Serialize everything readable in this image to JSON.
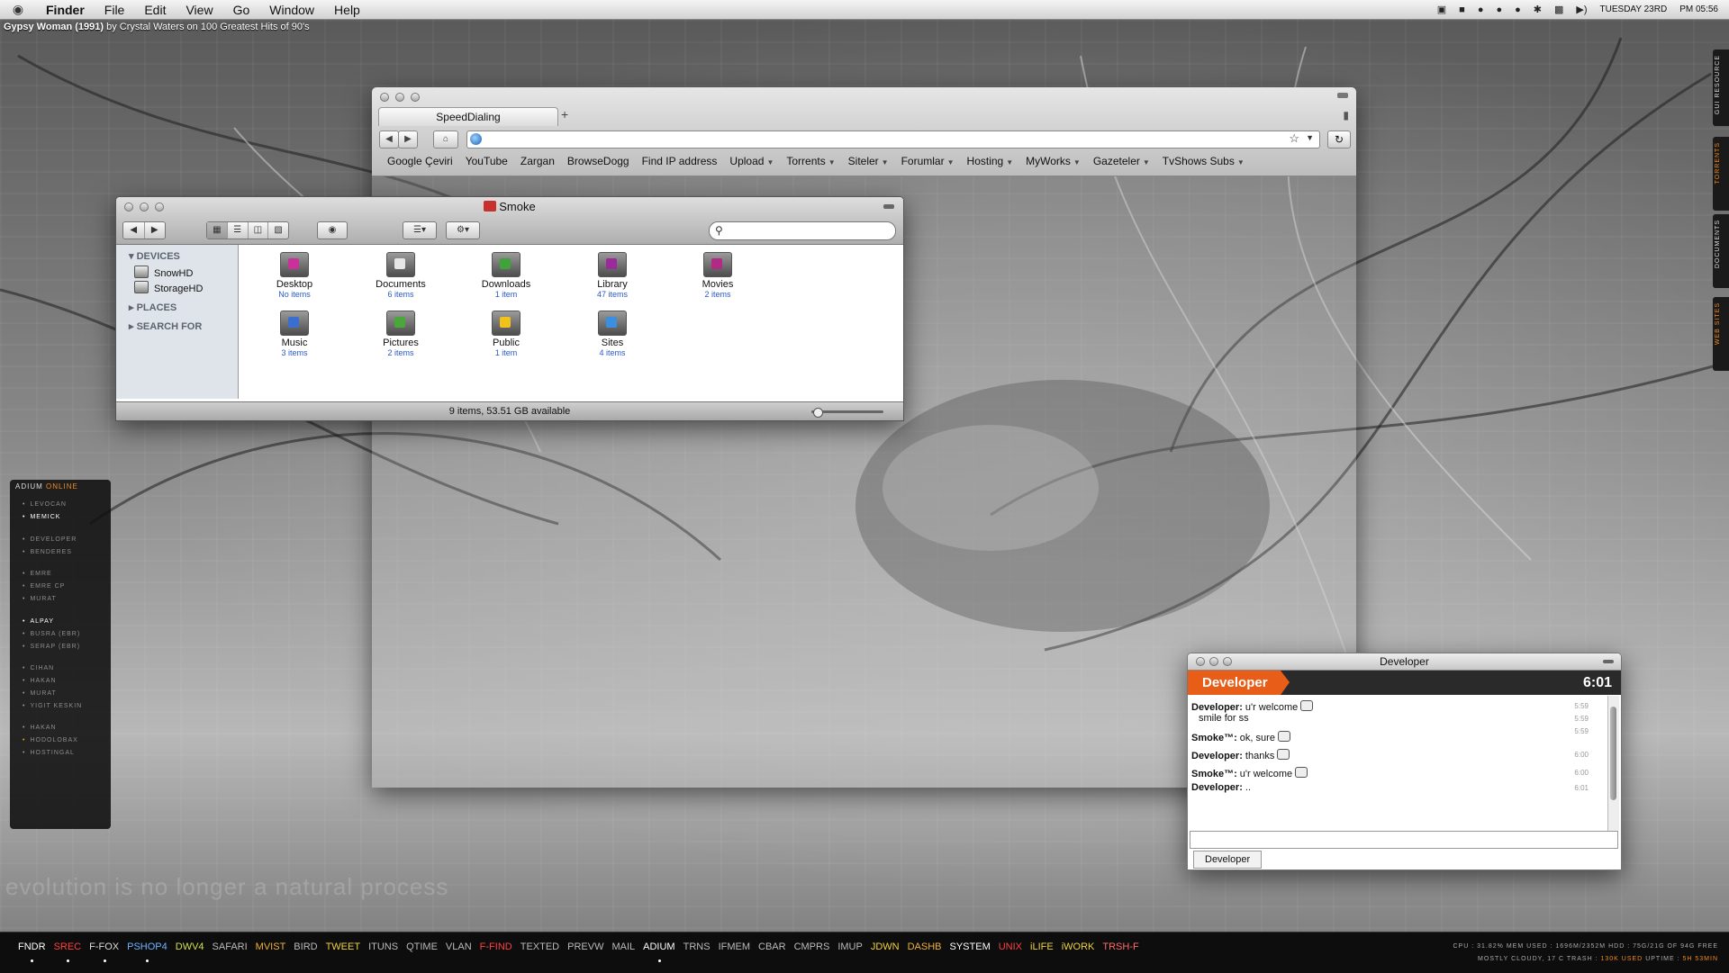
{
  "menubar": {
    "app": "Finder",
    "items": [
      "File",
      "Edit",
      "View",
      "Go",
      "Window",
      "Help"
    ],
    "date": "TUESDAY 23RD",
    "time": "PM 05:56"
  },
  "now_playing": {
    "track": "Gypsy Woman (1991)",
    "rest": " by Crystal Waters on 100 Greatest Hits of 90's"
  },
  "wallpaper_tagline": "evolution is no longer a natural process",
  "browser": {
    "tab": "SpeedDialing",
    "url": "",
    "bookmarks": [
      {
        "label": "Google Çeviri",
        "menu": false
      },
      {
        "label": "YouTube",
        "menu": false
      },
      {
        "label": "Zargan",
        "menu": false
      },
      {
        "label": "BrowseDogg",
        "menu": false
      },
      {
        "label": "Find IP address",
        "menu": false
      },
      {
        "label": "Upload",
        "menu": true
      },
      {
        "label": "Torrents",
        "menu": true
      },
      {
        "label": "Siteler",
        "menu": true
      },
      {
        "label": "Forumlar",
        "menu": true
      },
      {
        "label": "Hosting",
        "menu": true
      },
      {
        "label": "MyWorks",
        "menu": true
      },
      {
        "label": "Gazeteler",
        "menu": true
      },
      {
        "label": "TvShows Subs",
        "menu": true
      }
    ]
  },
  "finder": {
    "title": "Smoke",
    "sidebar": {
      "devices_header": "DEVICES",
      "devices": [
        "SnowHD",
        "StorageHD"
      ],
      "places_header": "PLACES",
      "search_header": "SEARCH FOR"
    },
    "items": [
      {
        "name": "Desktop",
        "count": "No items",
        "color": "#c8309a"
      },
      {
        "name": "Documents",
        "count": "6 items",
        "color": "#e6e6e6"
      },
      {
        "name": "Downloads",
        "count": "1 item",
        "color": "#3fa33a"
      },
      {
        "name": "Library",
        "count": "47 items",
        "color": "#9b2a9a"
      },
      {
        "name": "Movies",
        "count": "2 items",
        "color": "#b02a86"
      },
      {
        "name": "Music",
        "count": "3 items",
        "color": "#3a6fd0"
      },
      {
        "name": "Pictures",
        "count": "2 items",
        "color": "#4aa83a"
      },
      {
        "name": "Public",
        "count": "1 item",
        "color": "#f2c21a"
      },
      {
        "name": "Sites",
        "count": "4 items",
        "color": "#3a8fe0"
      }
    ],
    "status": "9 items, 53.51 GB available"
  },
  "adium": {
    "header": "ADIUM",
    "status": "ONLINE",
    "contacts": [
      {
        "name": "LEVOCAN",
        "state": "off"
      },
      {
        "name": "MEMICK",
        "state": "on"
      },
      {
        "name": "DEVELOPER",
        "state": "off"
      },
      {
        "name": "BENDERES",
        "state": "off"
      },
      {
        "name": "EMRE",
        "state": "off"
      },
      {
        "name": "EMRE CP",
        "state": "off"
      },
      {
        "name": "MURAT",
        "state": "off"
      },
      {
        "name": "ALPAY",
        "state": "on"
      },
      {
        "name": "BUSRA (EBR)",
        "state": "off"
      },
      {
        "name": "SERAP (EBR)",
        "state": "off"
      },
      {
        "name": "CIHAN",
        "state": "off"
      },
      {
        "name": "HAKAN",
        "state": "off"
      },
      {
        "name": "MURAT",
        "state": "off"
      },
      {
        "name": "YIGIT KESKIN",
        "state": "off"
      },
      {
        "name": "HAKAN",
        "state": "off"
      },
      {
        "name": "HODOLOBAX",
        "state": "away"
      },
      {
        "name": "HOSTINGAL",
        "state": "off"
      }
    ]
  },
  "chat": {
    "window_title": "Developer",
    "contact": "Developer",
    "time": "6:01",
    "messages": [
      {
        "sender": "Developer:",
        "text": " u'r welcome",
        "time": "5:59",
        "emoticon": true
      },
      {
        "sender": "",
        "text": "smile for ss",
        "time": "5:59",
        "emoticon": false
      },
      {
        "sender": "",
        "text": "",
        "time": "5:59",
        "emoticon": false
      },
      {
        "sender": "Smoke™:",
        "text": " ok, sure",
        "time": "",
        "emoticon": true
      },
      {
        "sender": "Developer:",
        "text": " thanks",
        "time": "6:00",
        "emoticon": true
      },
      {
        "sender": "Smoke™:",
        "text": " u'r welcome",
        "time": "6:00",
        "emoticon": true
      },
      {
        "sender": "Developer:",
        "text": " ..",
        "time": "6:01",
        "emoticon": false
      }
    ],
    "tab": "Developer"
  },
  "drawers": [
    {
      "label": "GUI RESOURCE",
      "accent": false
    },
    {
      "label": "TORRENTS",
      "accent": true
    },
    {
      "label": "DOCUMENTS",
      "accent": false
    },
    {
      "label": "WEB SITES",
      "accent": true
    }
  ],
  "dock": {
    "apps": [
      {
        "label": "FNDR",
        "color": "#ffffff",
        "dot": true
      },
      {
        "label": "SREC",
        "color": "#ff4040",
        "dot": true
      },
      {
        "label": "F-FOX",
        "color": "#dddddd",
        "dot": true
      },
      {
        "label": "PSHOP4",
        "color": "#6fb4ff",
        "dot": true
      },
      {
        "label": "DWV4",
        "color": "#d6e04a",
        "dot": false
      },
      {
        "label": "SAFARI",
        "color": "#bbbbbb",
        "dot": false
      },
      {
        "label": "MVIST",
        "color": "#f0b23a",
        "dot": false
      },
      {
        "label": "BIRD",
        "color": "#bbbbbb",
        "dot": false
      },
      {
        "label": "TWEET",
        "color": "#f0d23a",
        "dot": false
      },
      {
        "label": "ITUNS",
        "color": "#bbbbbb",
        "dot": false
      },
      {
        "label": "QTIME",
        "color": "#bbbbbb",
        "dot": false
      },
      {
        "label": "VLAN",
        "color": "#bbbbbb",
        "dot": false
      },
      {
        "label": "F-FIND",
        "color": "#ff4040",
        "dot": false
      },
      {
        "label": "TEXTED",
        "color": "#bbbbbb",
        "dot": false
      },
      {
        "label": "PREVW",
        "color": "#bbbbbb",
        "dot": false
      },
      {
        "label": "MAIL",
        "color": "#bbbbbb",
        "dot": false
      },
      {
        "label": "ADIUM",
        "color": "#ffffff",
        "dot": true
      },
      {
        "label": "TRNS",
        "color": "#bbbbbb",
        "dot": false
      },
      {
        "label": "IFMEM",
        "color": "#bbbbbb",
        "dot": false
      },
      {
        "label": "CBAR",
        "color": "#bbbbbb",
        "dot": false
      },
      {
        "label": "CMPRS",
        "color": "#bbbbbb",
        "dot": false
      },
      {
        "label": "IMUP",
        "color": "#bbbbbb",
        "dot": false
      },
      {
        "label": "JDWN",
        "color": "#f0d23a",
        "dot": false
      },
      {
        "label": "DASHB",
        "color": "#f0b23a",
        "dot": false
      },
      {
        "label": "SYSTEM",
        "color": "#ffffff",
        "dot": false
      },
      {
        "label": "UNIX",
        "color": "#ff4040",
        "dot": false
      },
      {
        "label": "iLIFE",
        "color": "#f0d23a",
        "dot": false
      },
      {
        "label": "iWORK",
        "color": "#f0d23a",
        "dot": false
      },
      {
        "label": "TRSH-F",
        "color": "#ff6a6a",
        "dot": false
      }
    ],
    "stats_line1": [
      {
        "k": "CPU :",
        "v": "31.82%"
      },
      {
        "k": "MEM USED :",
        "v": "1696M/2352M"
      },
      {
        "k": "HDD :",
        "v": "75G/21G OF 94G FREE"
      }
    ],
    "stats_line2": [
      {
        "k": "",
        "v": "MOSTLY CLOUDY, 17 C"
      },
      {
        "k": "TRASH :",
        "v": "130K USED"
      },
      {
        "k": "UPTIME :",
        "v": "5H 53MIN"
      }
    ]
  }
}
